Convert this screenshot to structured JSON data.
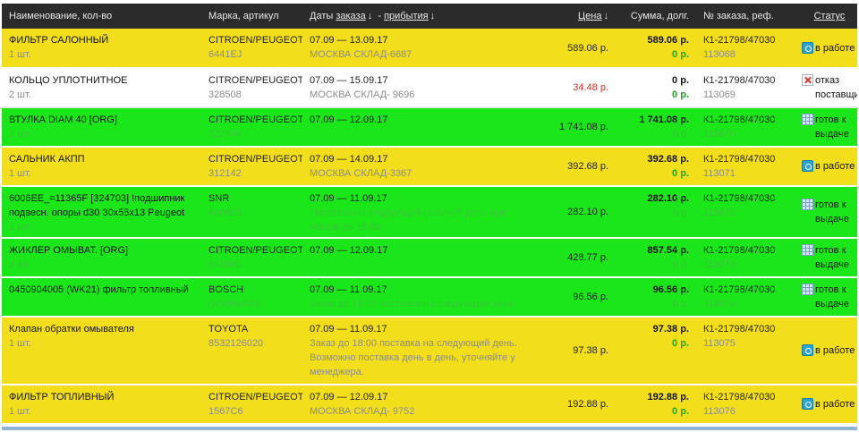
{
  "header": {
    "name": "Наименование, кол-во",
    "brand": "Марка, артикул",
    "dates_prefix": "Даты",
    "dates_order": "заказа",
    "dates_sep": "-",
    "dates_arrival": "прибытия",
    "price": "Цена",
    "sum": "Сумма, долг.",
    "order": "№ заказа, реф.",
    "status": "Статус",
    "sort_arrow": "↓"
  },
  "rows": [
    {
      "color": "yellow",
      "name": "ФИЛЬТР САЛОННЫЙ",
      "qty": "1 шт.",
      "brand": "CITROEN/PEUGEOT",
      "code": "6441EJ",
      "dates": "07.09 — 13.09.17",
      "info": "МОСКВА СКЛАД-6687",
      "price": "589.06 р.",
      "price_red": false,
      "sum": "589.06 р.",
      "debt": "0 р.",
      "order": "К1-21798/47030",
      "ref": "113068",
      "status_icon": "work",
      "status": "в работе"
    },
    {
      "color": "white",
      "name": "КОЛЬЦО УПЛОТНИТНОЕ",
      "qty": "2 шт.",
      "brand": "CITROEN/PEUGEOT",
      "code": "328508",
      "dates": "07.09 — 15.09.17",
      "info": "МОСКВА СКЛАД- 9696",
      "price": "34.48 р.",
      "price_red": true,
      "sum": "0 р.",
      "debt": "0 р.",
      "order": "К1-21798/47030",
      "ref": "113069",
      "status_icon": "refuse",
      "status": "отказ поставщика"
    },
    {
      "color": "green",
      "name": "ВТУЛКА DIAM 40 [ORG]",
      "qty": "1 шт.",
      "brand": "CITROEN/PEUGEOT",
      "code": "322404",
      "dates": "07.09 — 12.09.17",
      "info": "",
      "price": "1 741.08 р.",
      "price_red": false,
      "sum": "1 741.08 р.",
      "debt": "0 р.",
      "order": "К1-21798/47030",
      "ref": "113070",
      "status_icon": "grid",
      "status": "готов к выдаче"
    },
    {
      "color": "yellow",
      "name": "САЛЬНИК АКПП",
      "qty": "1 шт.",
      "brand": "CITROEN/PEUGEOT",
      "code": "312142",
      "dates": "07.09 — 14.09.17",
      "info": "МОСКВА СКЛАД-3367",
      "price": "392.68 р.",
      "price_red": false,
      "sum": "392.68 р.",
      "debt": "0 р.",
      "order": "К1-21798/47030",
      "ref": "113071",
      "status_icon": "work",
      "status": "в работе"
    },
    {
      "color": "green",
      "name": "6006EE_=11365F [324703] !подшипник подвесн. опоры d30 30x55x13 Peugeot",
      "qty": "1 шт.",
      "brand": "SNR",
      "code": "6006EE",
      "dates": "07.09 — 11.09.17",
      "info": "Поставка на следующий рабочий день при заказе до 18:00",
      "price": "282.10 р.",
      "price_red": false,
      "sum": "282.10 р.",
      "debt": "0 р.",
      "order": "К1-21798/47030",
      "ref": "113072",
      "status_icon": "grid",
      "status": "готов к выдаче"
    },
    {
      "color": "green",
      "name": "ЖИКЛЕР ОМЫВАТ. [ORG]",
      "qty": "2 шт.",
      "brand": "CITROEN/PEUGEOT",
      "code": "643851",
      "dates": "07.09 — 12.09.17",
      "info": "",
      "price": "428.77 р.",
      "price_red": false,
      "sum": "857.54 р.",
      "debt": "0 р.",
      "order": "К1-21798/47030",
      "ref": "113073",
      "status_icon": "grid",
      "status": "готов к выдаче"
    },
    {
      "color": "green",
      "name": "0450904005 (WK21) фильтр топливный",
      "qty": "",
      "brand": "BOSCH",
      "code": "0450904005",
      "dates": "07.09 — 11.09.17",
      "info": "Заказ до 18:00 поставка на следующий день.",
      "price": "96.56 р.",
      "price_red": false,
      "sum": "96.56 р.",
      "debt": "0 р.",
      "order": "К1-21798/47030",
      "ref": "113074",
      "status_icon": "grid",
      "status": "готов к выдаче"
    },
    {
      "color": "yellow",
      "name": "Клапан обратки омывателя",
      "qty": "1 шт.",
      "brand": "TOYOTA",
      "code": "8532126020",
      "dates": "07.09 — 11.09.17",
      "info": "Заказ до 18:00 поставка на следующий день. Возможно поставка день в день, уточняйте у менеджера.",
      "price": "97.38 р.",
      "price_red": false,
      "sum": "97.38 р.",
      "debt": "0 р.",
      "order": "К1-21798/47030",
      "ref": "113075",
      "status_icon": "work",
      "status": "в работе"
    },
    {
      "color": "yellow",
      "name": "ФИЛЬТР ТОПЛИВНЫЙ",
      "qty": "1 шт.",
      "brand": "CITROEN/PEUGEOT",
      "code": "1567C6",
      "dates": "07.09 — 12.09.17",
      "info": "МОСКВА СКЛАД- 9752",
      "price": "192.88 р.",
      "price_red": false,
      "sum": "192.88 р.",
      "debt": "0 р.",
      "order": "К1-21798/47030",
      "ref": "113076",
      "status_icon": "work",
      "status": "в работе"
    }
  ],
  "colors": {
    "yellow": "#f2de1b",
    "green": "#1ae61a",
    "white": "#ffffff",
    "header": "#2b2b2b",
    "price_red": "#d9322b",
    "debt_green": "#1aa61a"
  }
}
